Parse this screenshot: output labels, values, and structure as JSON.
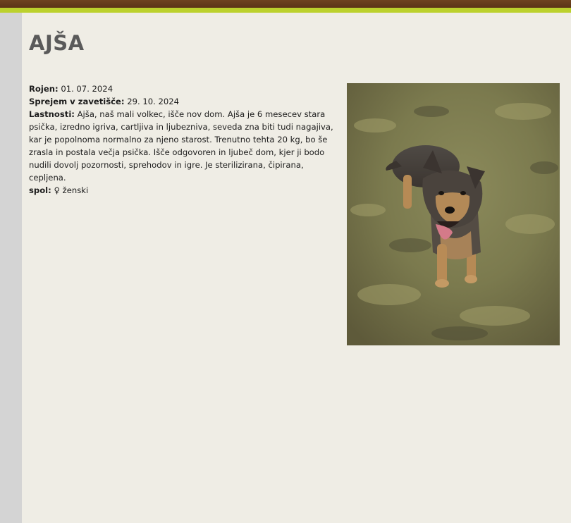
{
  "pet": {
    "name": "AJŠA",
    "born_label": "Rojen:",
    "born_value": "01. 07. 2024",
    "intake_label": "Sprejem v zavetišče:",
    "intake_value": "29. 10. 2024",
    "traits_label": "Lastnosti:",
    "traits_value": "Ajša, naš mali volkec, išče nov dom. Ajša je 6 mesecev stara psička, izredno igriva, cartljiva in ljubezniva, seveda zna biti tudi nagajiva, kar je popolnoma normalno za njeno starost. Trenutno tehta 20 kg, bo še zrasla in postala večja psička. Išče odgovoren in ljubeč dom, kjer ji bodo nudili dovolj pozornosti, sprehodov in igre. Je sterilizirana, čipirana, cepljena.",
    "sex_label": "spol:",
    "sex_value": "♀ ženski"
  },
  "colors": {
    "header_brown": "#6e4320",
    "accent_green": "#bcd12d",
    "page_bg": "#efede5",
    "sidebar_gray": "#d4d4d4",
    "title_gray": "#5a5a5a"
  }
}
